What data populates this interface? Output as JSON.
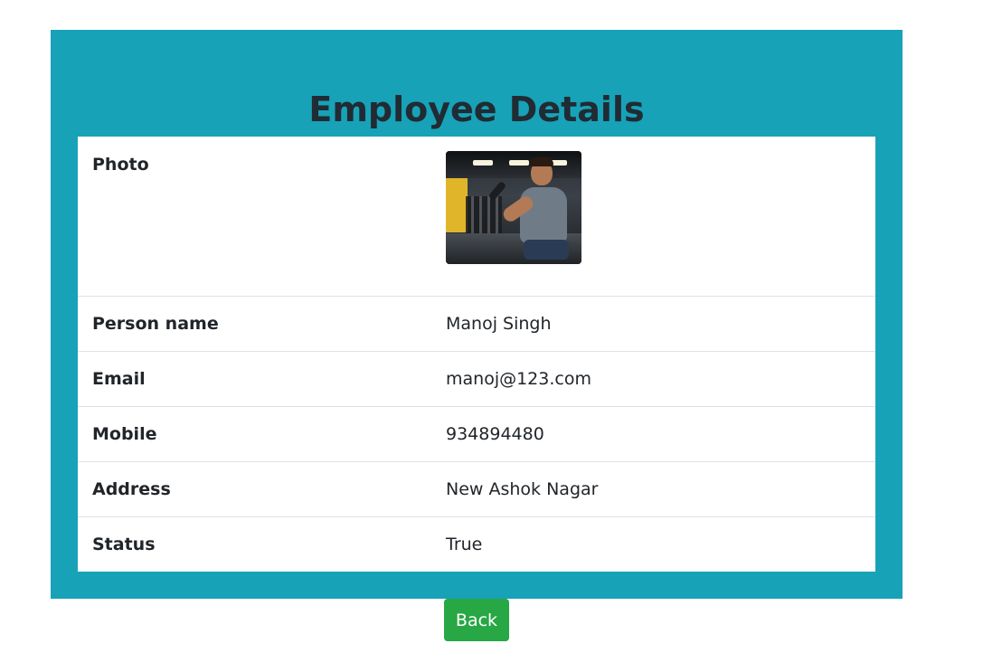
{
  "page": {
    "title": "Employee Details"
  },
  "details": {
    "photo_label": "Photo",
    "rows": [
      {
        "label": "Person name",
        "value": "Manoj Singh"
      },
      {
        "label": "Email",
        "value": "manoj@123.com"
      },
      {
        "label": "Mobile",
        "value": "934894480"
      },
      {
        "label": "Address",
        "value": "New Ashok Nagar"
      },
      {
        "label": "Status",
        "value": "True"
      }
    ]
  },
  "actions": {
    "back_label": "Back"
  },
  "colors": {
    "panel_bg": "#17a2b8",
    "back_button_bg": "#28a745"
  }
}
